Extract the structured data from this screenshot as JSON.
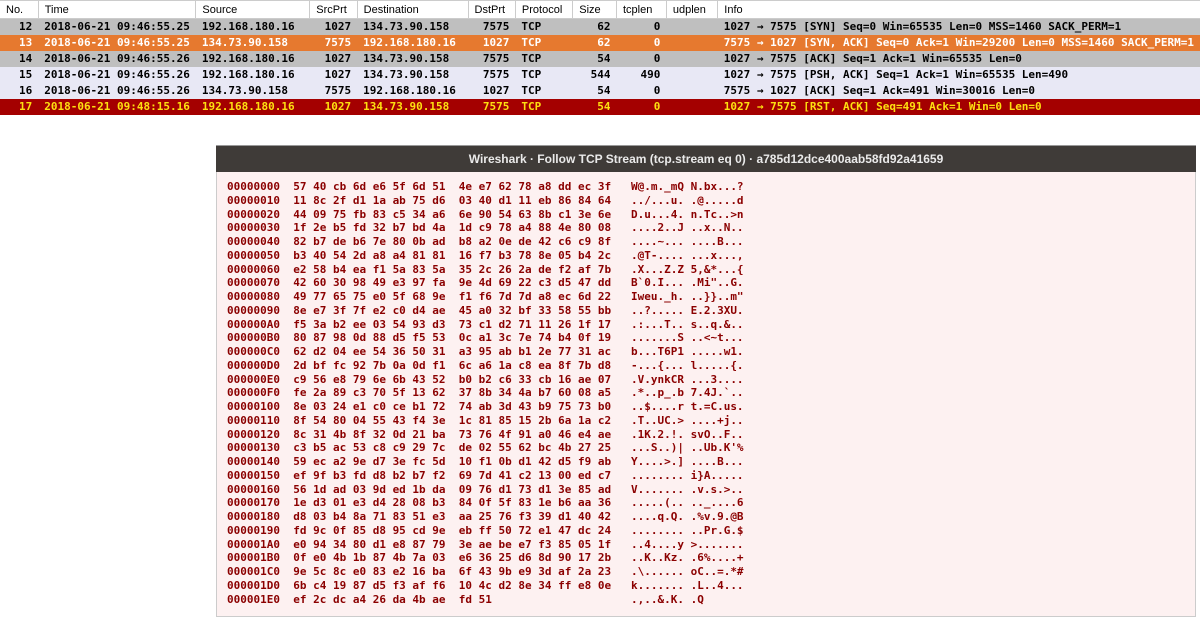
{
  "columns": {
    "no": "No.",
    "time": "Time",
    "source": "Source",
    "srcprt": "SrcPrt",
    "destination": "Destination",
    "dstprt": "DstPrt",
    "protocol": "Protocol",
    "size": "Size",
    "tcplen": "tcplen",
    "udplen": "udplen",
    "info": "Info"
  },
  "packets": [
    {
      "cls": "row-gray",
      "no": "12",
      "time": "2018-06-21 09:46:55.25",
      "src": "192.168.180.16",
      "srcprt": "1027",
      "dst": "134.73.90.158",
      "dstprt": "7575",
      "proto": "TCP",
      "size": "62",
      "tcplen": "0",
      "udplen": "",
      "info": "1027 → 7575 [SYN] Seq=0 Win=65535 Len=0 MSS=1460 SACK_PERM=1"
    },
    {
      "cls": "row-orange",
      "no": "13",
      "time": "2018-06-21 09:46:55.25",
      "src": "134.73.90.158",
      "srcprt": "7575",
      "dst": "192.168.180.16",
      "dstprt": "1027",
      "proto": "TCP",
      "size": "62",
      "tcplen": "0",
      "udplen": "",
      "info": "7575 → 1027 [SYN, ACK] Seq=0 Ack=1 Win=29200 Len=0 MSS=1460 SACK_PERM=1"
    },
    {
      "cls": "row-gray",
      "no": "14",
      "time": "2018-06-21 09:46:55.26",
      "src": "192.168.180.16",
      "srcprt": "1027",
      "dst": "134.73.90.158",
      "dstprt": "7575",
      "proto": "TCP",
      "size": "54",
      "tcplen": "0",
      "udplen": "",
      "info": "1027 → 7575 [ACK] Seq=1 Ack=1 Win=65535 Len=0"
    },
    {
      "cls": "row-lav",
      "no": "15",
      "time": "2018-06-21 09:46:55.26",
      "src": "192.168.180.16",
      "srcprt": "1027",
      "dst": "134.73.90.158",
      "dstprt": "7575",
      "proto": "TCP",
      "size": "544",
      "tcplen": "490",
      "udplen": "",
      "info": "1027 → 7575 [PSH, ACK] Seq=1 Ack=1 Win=65535 Len=490"
    },
    {
      "cls": "row-lav",
      "no": "16",
      "time": "2018-06-21 09:46:55.26",
      "src": "134.73.90.158",
      "srcprt": "7575",
      "dst": "192.168.180.16",
      "dstprt": "1027",
      "proto": "TCP",
      "size": "54",
      "tcplen": "0",
      "udplen": "",
      "info": "7575 → 1027 [ACK] Seq=1 Ack=491 Win=30016 Len=0"
    },
    {
      "cls": "row-red",
      "no": "17",
      "time": "2018-06-21 09:48:15.16",
      "src": "192.168.180.16",
      "srcprt": "1027",
      "dst": "134.73.90.158",
      "dstprt": "7575",
      "proto": "TCP",
      "size": "54",
      "tcplen": "0",
      "udplen": "",
      "info": "1027 → 7575 [RST, ACK] Seq=491 Ack=1 Win=0 Len=0"
    }
  ],
  "stream": {
    "title": "Wireshark · Follow TCP Stream (tcp.stream eq 0) · a785d12dce400aab58fd92a41659",
    "lines": [
      "00000000  57 40 cb 6d e6 5f 6d 51  4e e7 62 78 a8 dd ec 3f   W@.m._mQ N.bx...?",
      "00000010  11 8c 2f d1 1a ab 75 d6  03 40 d1 11 eb 86 84 64   ../...u. .@.....d",
      "00000020  44 09 75 fb 83 c5 34 a6  6e 90 54 63 8b c1 3e 6e   D.u...4. n.Tc..>n",
      "00000030  1f 2e b5 fd 32 b7 bd 4a  1d c9 78 a4 88 4e 80 08   ....2..J ..x..N..",
      "00000040  82 b7 de b6 7e 80 0b ad  b8 a2 0e de 42 c6 c9 8f   ....~... ....B...",
      "00000050  b3 40 54 2d a8 a4 81 81  16 f7 b3 78 8e 05 b4 2c   .@T-.... ...x...,",
      "00000060  e2 58 b4 ea f1 5a 83 5a  35 2c 26 2a de f2 af 7b   .X...Z.Z 5,&*...{",
      "00000070  42 60 30 98 49 e3 97 fa  9e 4d 69 22 c3 d5 47 dd   B`0.I... .Mi\"..G.",
      "00000080  49 77 65 75 e0 5f 68 9e  f1 f6 7d 7d a8 ec 6d 22   Iweu._h. ..}}..m\"",
      "00000090  8e e7 3f 7f e2 c0 d4 ae  45 a0 32 bf 33 58 55 bb   ..?..... E.2.3XU.",
      "000000A0  f5 3a b2 ee 03 54 93 d3  73 c1 d2 71 11 26 1f 17   .:...T.. s..q.&..",
      "000000B0  80 87 98 0d 88 d5 f5 53  0c a1 3c 7e 74 b4 0f 19   .......S ..<~t...",
      "000000C0  62 d2 04 ee 54 36 50 31  a3 95 ab b1 2e 77 31 ac   b...T6P1 .....w1.",
      "000000D0  2d bf fc 92 7b 0a 0d f1  6c a6 1a c8 ea 8f 7b d8   -...{... l.....{.",
      "000000E0  c9 56 e8 79 6e 6b 43 52  b0 b2 c6 33 cb 16 ae 07   .V.ynkCR ...3....",
      "000000F0  fe 2a 89 c3 70 5f 13 62  37 8b 34 4a b7 60 08 a5   .*..p_.b 7.4J.`..",
      "00000100  8e 03 24 e1 c0 ce b1 72  74 ab 3d 43 b9 75 73 b0   ..$....r t.=C.us.",
      "00000110  8f 54 80 04 55 43 f4 3e  1c 81 85 15 2b 6a 1a c2   .T..UC.> ....+j..",
      "00000120  8c 31 4b 8f 32 0d 21 ba  73 76 4f 91 a0 46 e4 ae   .1K.2.!. svO..F..",
      "00000130  c3 b5 ac 53 c8 c9 29 7c  de 02 55 62 bc 4b 27 25   ...S..)| ..Ub.K'%",
      "00000140  59 ec a2 9e d7 3e fc 5d  10 f1 0b d1 42 d5 f9 ab   Y....>.] ....B...",
      "00000150  ef 9f b3 fd d8 b2 b7 f2  69 7d 41 c2 13 00 ed c7   ........ i}A.....",
      "00000160  56 1d ad 03 9d ed 1b da  09 76 d1 73 d1 3e 85 ad   V....... .v.s.>..",
      "00000170  1e d3 01 e3 d4 28 08 b3  84 0f 5f 83 1e b6 aa 36   .....(.. .._....6",
      "00000180  d8 03 b4 8a 71 83 51 e3  aa 25 76 f3 39 d1 40 42   ....q.Q. .%v.9.@B",
      "00000190  fd 9c 0f 85 d8 95 cd 9e  eb ff 50 72 e1 47 dc 24   ........ ..Pr.G.$",
      "000001A0  e0 94 34 80 d1 e8 87 79  3e ae be e7 f3 85 05 1f   ..4....y >.......",
      "000001B0  0f e0 4b 1b 87 4b 7a 03  e6 36 25 d6 8d 90 17 2b   ..K..Kz. .6%....+",
      "000001C0  9e 5c 8c e0 83 e2 16 ba  6f 43 9b e9 3d af 2a 23   .\\...... oC..=.*#",
      "000001D0  6b c4 19 87 d5 f3 af f6  10 4c d2 8e 34 ff e8 0e   k....... .L..4...",
      "000001E0  ef 2c dc a4 26 da 4b ae  fd 51                     .,..&.K. .Q"
    ]
  }
}
